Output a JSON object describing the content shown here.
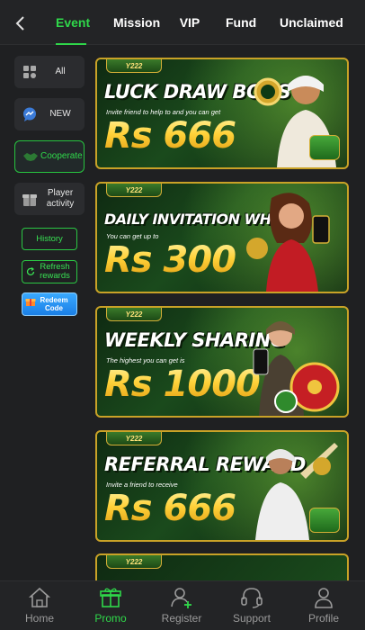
{
  "tabs": [
    {
      "label": "Event",
      "active": true
    },
    {
      "label": "Mission",
      "active": false
    },
    {
      "label": "VIP",
      "active": false
    },
    {
      "label": "Fund",
      "active": false
    },
    {
      "label": "Unclaimed",
      "active": false
    }
  ],
  "sidebar": {
    "categories": [
      {
        "label": "All",
        "icon": "grid-icon",
        "active": false
      },
      {
        "label": "NEW",
        "icon": "chat-icon",
        "active": false
      },
      {
        "label": "Cooperate",
        "icon": "handshake-icon",
        "active": true
      },
      {
        "label": "Player activity",
        "icon": "gift-icon",
        "active": false
      }
    ],
    "history_label": "History",
    "refresh_label": "Refresh rewards",
    "redeem_label": "Redeem Code"
  },
  "banners": [
    {
      "logo": "Y222",
      "title": "LUCK DRAW BOOST",
      "subtitle": "Invite friend to help to and you can get",
      "amount": "Rs 666",
      "figure": "man-with-watch-icon"
    },
    {
      "logo": "Y222",
      "title": "DAILY INVITATION WHEEL",
      "subtitle": "You can get up to",
      "amount": "Rs 300",
      "figure": "woman-with-phone-icon"
    },
    {
      "logo": "Y222",
      "title": "WEEKLY SHARING",
      "subtitle": "The highest you can get is",
      "amount": "Rs 1000",
      "figure": "woman-with-wheel-icon"
    },
    {
      "logo": "Y222",
      "title": "REFERRAL REWARD",
      "subtitle": "Invite a friend to receive",
      "amount": "Rs 666",
      "figure": "cricketer-icon"
    }
  ],
  "partial_banner_logo": "Y222",
  "bottom_nav": [
    {
      "label": "Home",
      "icon": "home-icon",
      "active": false
    },
    {
      "label": "Promo",
      "icon": "gift-box-icon",
      "active": true
    },
    {
      "label": "Register",
      "icon": "add-user-icon",
      "active": false
    },
    {
      "label": "Support",
      "icon": "headset-icon",
      "active": false
    },
    {
      "label": "Profile",
      "icon": "user-icon",
      "active": false
    }
  ],
  "colors": {
    "accent": "#2fd84a",
    "background": "#1f2022",
    "banner_gold": "#c9a227",
    "inactive_text": "#9a9a9a"
  }
}
